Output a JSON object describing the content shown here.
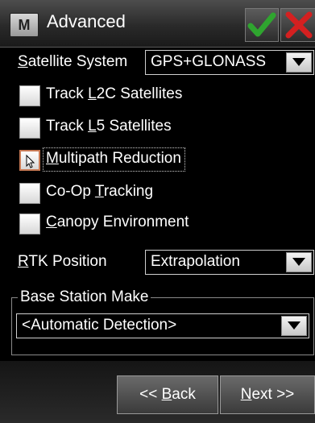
{
  "window": {
    "app_icon_letter": "M",
    "title": "Advanced"
  },
  "form": {
    "satellite_system": {
      "label_accel": "S",
      "label_rest": "atellite System",
      "value": "GPS+GLONASS"
    },
    "checkboxes": [
      {
        "pre": "Track ",
        "accel": "L",
        "post": "2C Satellites",
        "checked": false
      },
      {
        "pre": "Track ",
        "accel": "L",
        "post": "5 Satellites",
        "checked": false
      },
      {
        "pre": "",
        "accel": "M",
        "post": "ultipath Reduction",
        "checked": false,
        "focused": true
      },
      {
        "pre": "Co-Op ",
        "accel": "T",
        "post": "racking",
        "checked": false
      },
      {
        "pre": "",
        "accel": "C",
        "post": "anopy Environment",
        "checked": false
      }
    ],
    "rtk_position": {
      "label_accel": "R",
      "label_rest": "TK Position",
      "value": "Extrapolation"
    },
    "base_station": {
      "group_label": "Base Station Make",
      "value": "<Automatic Detection>"
    }
  },
  "nav": {
    "back_pre": "<< ",
    "back_accel": "B",
    "back_post": "ack",
    "next_accel": "N",
    "next_post": "ext >>"
  },
  "colors": {
    "ok_check": "#2fa52f",
    "cancel_x": "#d42020"
  },
  "icons": {
    "ok": "checkmark-icon",
    "cancel": "x-icon",
    "dropdown": "down-arrow-icon"
  }
}
